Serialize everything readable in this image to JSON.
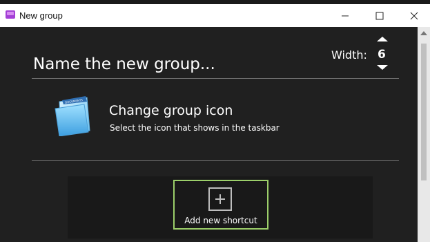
{
  "window": {
    "title": "New group"
  },
  "group_name": {
    "placeholder": "Name the new group...",
    "value": ""
  },
  "width_control": {
    "label": "Width:",
    "value": "6"
  },
  "group_icon": {
    "title": "Change group icon",
    "subtitle": "Select the icon that shows in the taskbar",
    "folder_tab_text": "DOCUMENTS"
  },
  "shortcuts": {
    "add_label": "Add new shortcut"
  },
  "colors": {
    "background": "#202020",
    "shortcut_panel": "#191919",
    "highlight_border": "#9ccf6a",
    "app_icon": "#a33fd6"
  }
}
